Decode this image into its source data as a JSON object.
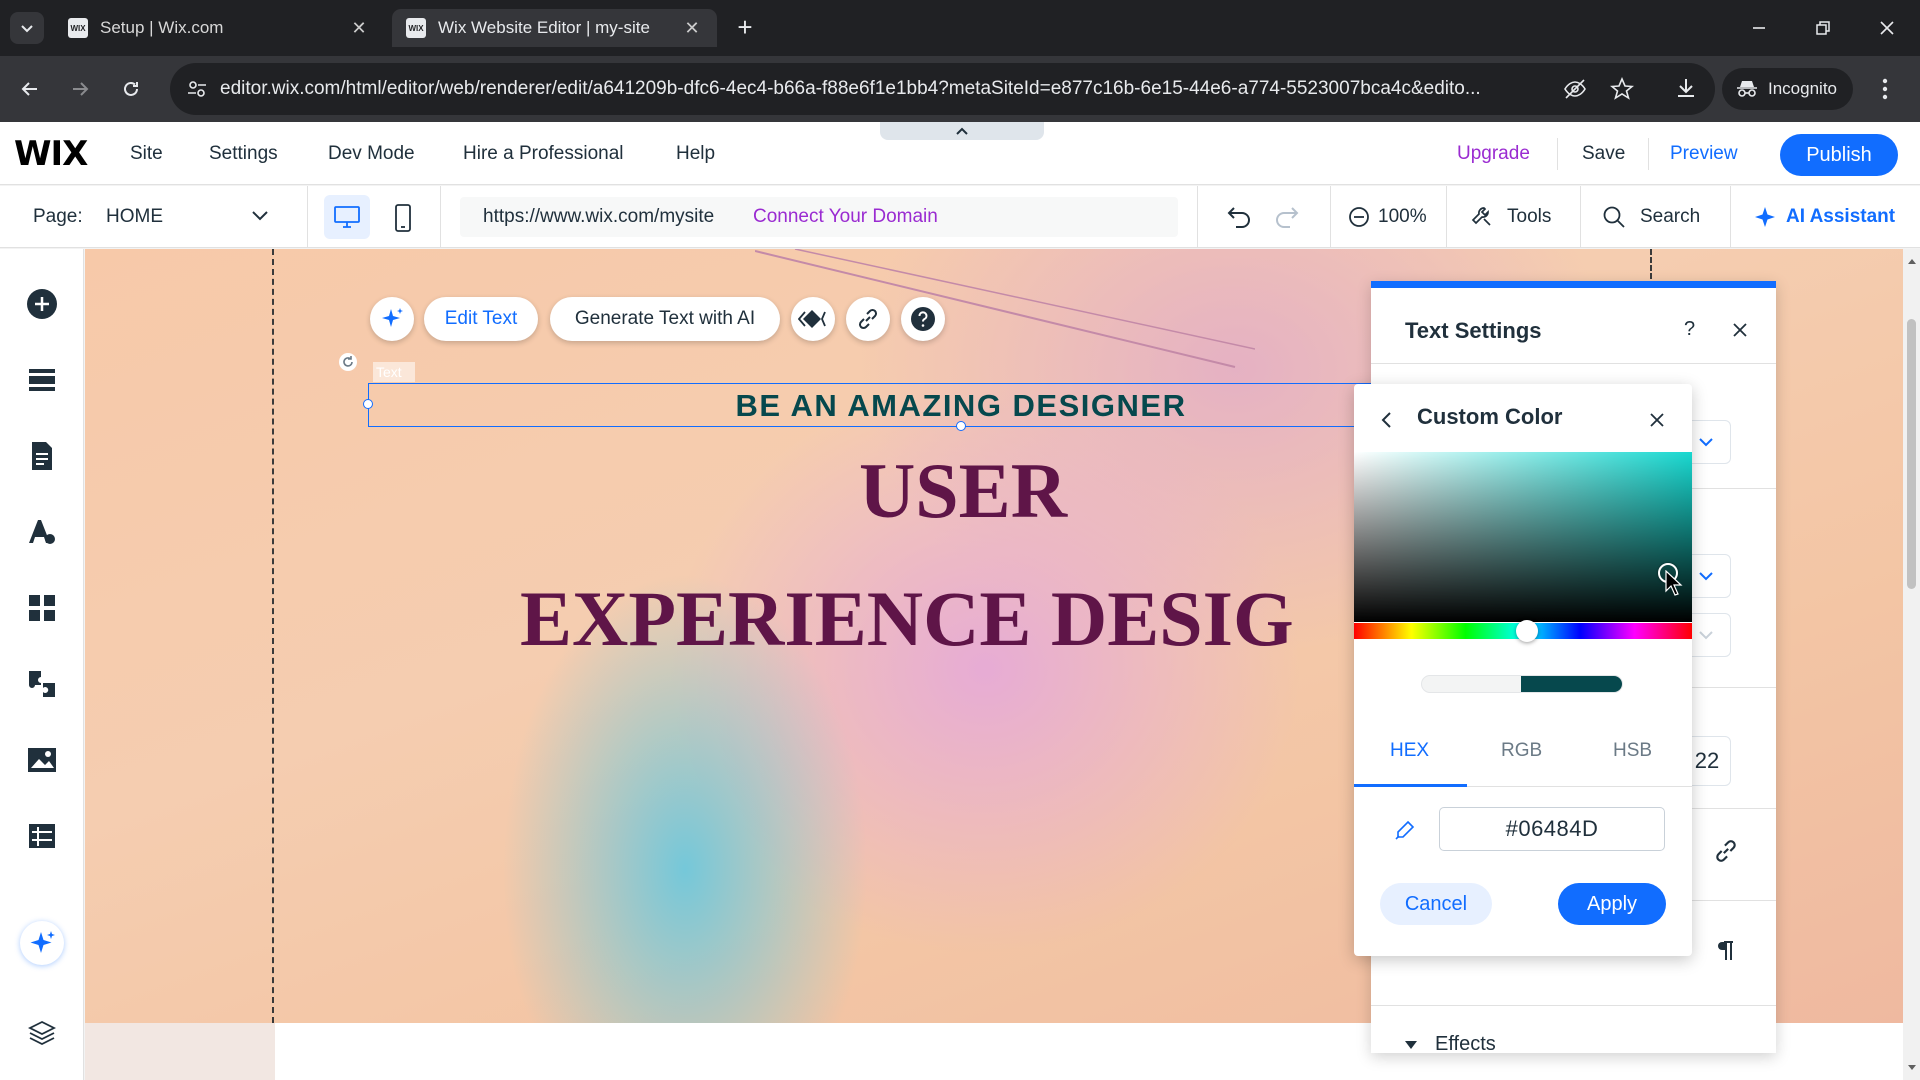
{
  "browser": {
    "tabs": [
      {
        "title": "Setup | Wix.com",
        "active": false
      },
      {
        "title": "Wix Website Editor | my-site",
        "active": true
      }
    ],
    "url": "editor.wix.com/html/editor/web/renderer/edit/a641209b-dfc6-4ec4-b66a-f88e6f1e1bb4?metaSiteId=e877c16b-6e15-44e6-a774-5523007bca4c&edito...",
    "incognito_label": "Incognito"
  },
  "wix": {
    "logo": "WIX",
    "menu": [
      "Site",
      "Settings",
      "Dev Mode",
      "Hire a Professional",
      "Help"
    ],
    "upgrade": "Upgrade",
    "save": "Save",
    "preview": "Preview",
    "publish": "Publish",
    "page_label": "Page:",
    "page_value": "HOME",
    "site_url": "https://www.wix.com/mysite",
    "connect_domain": "Connect Your Domain",
    "zoom": "100%",
    "tools": "Tools",
    "search": "Search",
    "ai_assistant": "AI Assistant"
  },
  "canvas": {
    "toolbar": {
      "edit_text": "Edit Text",
      "generate_text": "Generate Text with AI"
    },
    "element_tag": "Text",
    "headline_small": "BE AN AMAZING DESIGNER",
    "headline_user": "USER",
    "headline_exp": "EXPERIENCE DESIG"
  },
  "text_settings": {
    "title": "Text Settings",
    "font_size": "22",
    "effects": "Effects"
  },
  "custom_color": {
    "title": "Custom Color",
    "tabs": [
      "HEX",
      "RGB",
      "HSB"
    ],
    "active_tab": "HEX",
    "hex_value": "#06484D",
    "cancel": "Cancel",
    "apply": "Apply"
  },
  "colors": {
    "accent": "#116dff",
    "selected_color": "#06484D",
    "headline_color": "#5f1548",
    "upgrade_color": "#9a2bd1"
  }
}
